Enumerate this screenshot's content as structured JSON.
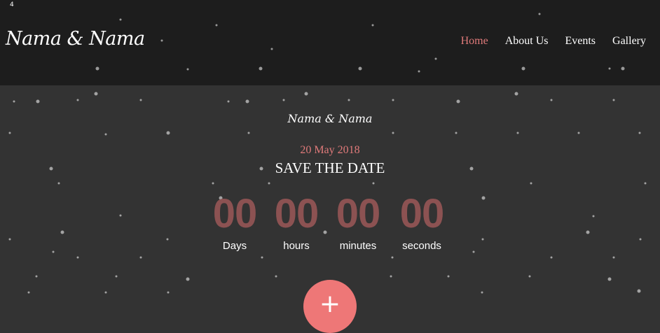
{
  "header": {
    "corner_mark": "4",
    "logo": "Nama & Nama",
    "nav": [
      {
        "label": "Home",
        "active": true
      },
      {
        "label": "About Us",
        "active": false
      },
      {
        "label": "Events",
        "active": false
      },
      {
        "label": "Gallery",
        "active": false
      }
    ]
  },
  "hero": {
    "mini_logo": "Nama & Nama",
    "date": "20 May 2018",
    "title": "SAVE THE DATE",
    "countdown": [
      {
        "value": "00",
        "label": "Days"
      },
      {
        "value": "00",
        "label": "hours"
      },
      {
        "value": "00",
        "label": "minutes"
      },
      {
        "value": "00",
        "label": "seconds"
      }
    ],
    "action_icon": "plus-icon"
  },
  "colors": {
    "accent": "#e07a7a",
    "countdown_number": "#8c5252",
    "header_bg": "#1d1d1d",
    "hero_bg": "#333333"
  }
}
